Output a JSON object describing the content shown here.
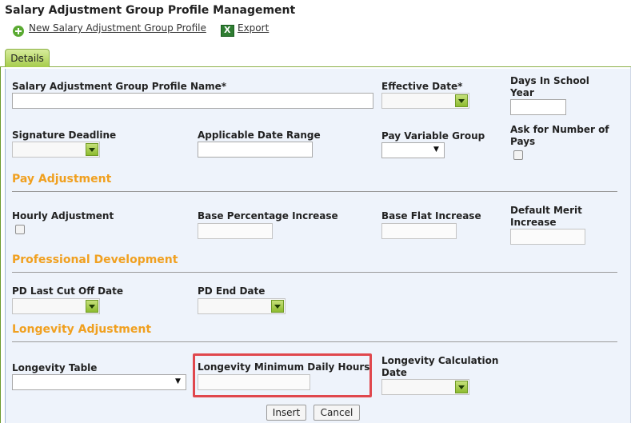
{
  "header": {
    "title": "Salary Adjustment Group Profile Management",
    "new_link": "New Salary Adjustment Group Profile",
    "export_link": "Export"
  },
  "tabs": [
    {
      "label": "Details",
      "active": true
    }
  ],
  "form": {
    "profile_name_label": "Salary Adjustment Group Profile Name*",
    "effective_date_label": "Effective Date*",
    "days_in_school_year_label_1": "Days In School",
    "days_in_school_year_label_2": "Year",
    "signature_deadline_label": "Signature Deadline",
    "applicable_date_range_label": "Applicable Date Range",
    "pay_variable_group_label": "Pay Variable Group",
    "ask_number_of_pays_label_1": "Ask for Number of",
    "ask_number_of_pays_label_2": "Pays"
  },
  "pay_adjustment": {
    "heading": "Pay Adjustment",
    "hourly_adjustment_label": "Hourly Adjustment",
    "base_percentage_label": "Base Percentage Increase",
    "base_flat_label": "Base Flat Increase",
    "default_merit_label_1": "Default Merit",
    "default_merit_label_2": "Increase"
  },
  "professional_development": {
    "heading": "Professional Development",
    "pd_last_cutoff_label": "PD Last Cut Off Date",
    "pd_end_label": "PD End Date"
  },
  "longevity": {
    "heading": "Longevity Adjustment",
    "table_label": "Longevity Table",
    "min_daily_hours_label": "Longevity Minimum Daily Hours",
    "calc_date_label_1": "Longevity Calculation",
    "calc_date_label_2": "Date"
  },
  "actions": {
    "insert_label": "Insert",
    "cancel_label": "Cancel"
  },
  "colors": {
    "section_heading": "#f0a020",
    "highlight_border": "#e0474d",
    "tab_green": "#a6cc4c"
  }
}
